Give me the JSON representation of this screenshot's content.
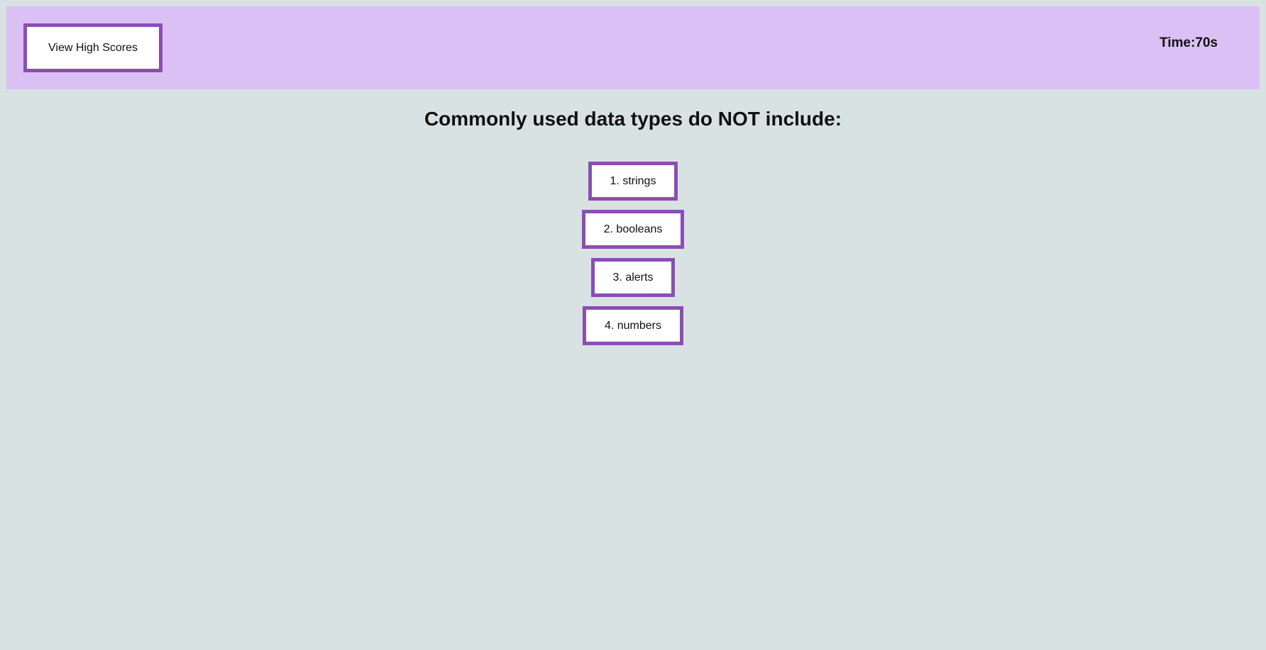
{
  "header": {
    "high_scores_label": "View High Scores",
    "timer_text": "Time:70s"
  },
  "quiz": {
    "question": "Commonly used data types do NOT include:",
    "answers": [
      "1. strings",
      "2. booleans",
      "3. alerts",
      "4. numbers"
    ]
  },
  "colors": {
    "page_background": "#d9e2e3",
    "header_background": "#dbc0f6",
    "button_border": "#8a4fb0",
    "button_background": "#ffffff"
  }
}
